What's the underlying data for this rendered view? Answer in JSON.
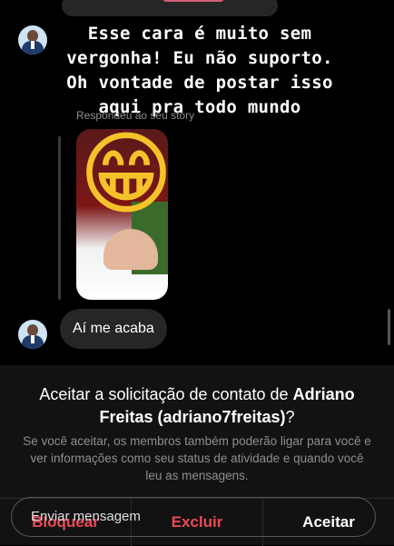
{
  "caption": {
    "line1": "Esse cara é muito sem",
    "line2": "vergonha! Eu não suporto.",
    "line3": "Oh vontade de postar isso",
    "line4": "aqui pra todo mundo"
  },
  "thread": {
    "reply_note": "Respondeu ao seu story",
    "emoji": "😁",
    "message": "Aí me acaba"
  },
  "request": {
    "title_prefix": "Aceitar a solicitação de contato de ",
    "requester": "Adriano Freitas (adriano7freitas)",
    "title_suffix": "?",
    "description": "Se você aceitar, os membros também poderão ligar para você e ver informações como seu status de atividade e quando você leu as mensagens.",
    "block_label": "Bloquear",
    "delete_label": "Excluir",
    "accept_label": "Aceitar"
  },
  "composer": {
    "placeholder": "Enviar mensagem"
  },
  "colors": {
    "destructive": "#ed4956",
    "background": "#000000",
    "panel": "#121212",
    "bubble": "#262626"
  }
}
